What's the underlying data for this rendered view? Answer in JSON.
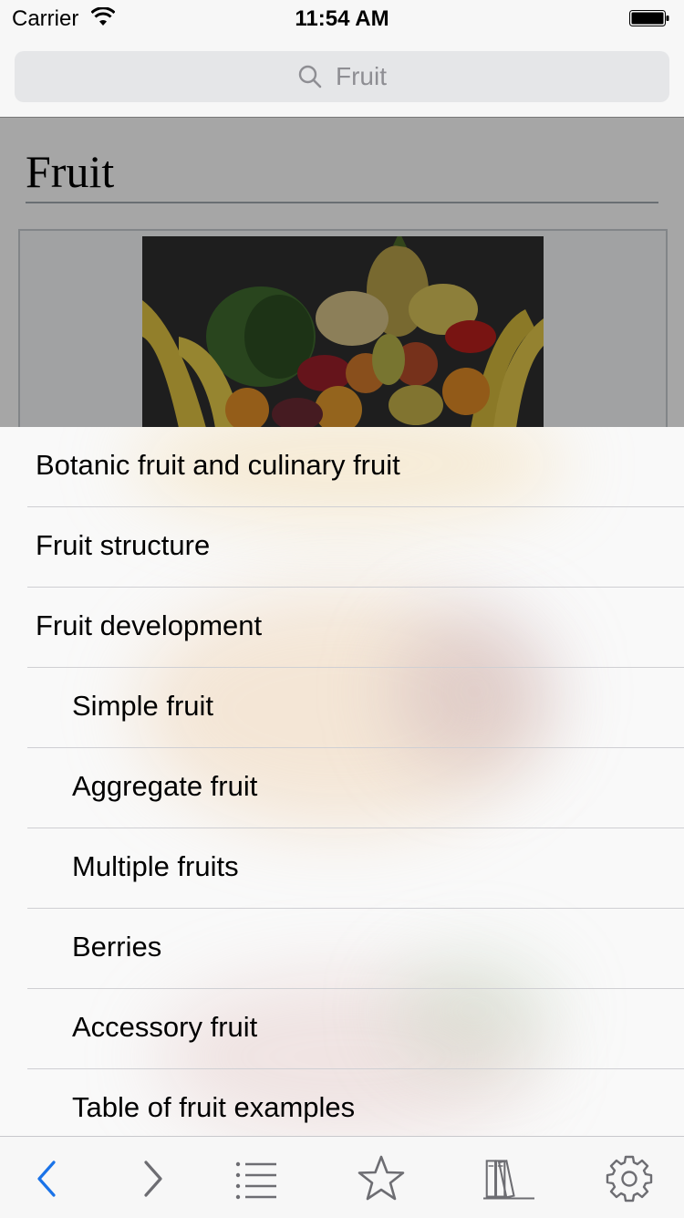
{
  "status_bar": {
    "carrier": "Carrier",
    "time": "11:54 AM"
  },
  "search": {
    "placeholder": "Fruit"
  },
  "article": {
    "title": "Fruit"
  },
  "toc": {
    "items": [
      {
        "label": "Botanic fruit and culinary fruit",
        "level": 1
      },
      {
        "label": "Fruit structure",
        "level": 1
      },
      {
        "label": "Fruit development",
        "level": 1
      },
      {
        "label": "Simple fruit",
        "level": 2
      },
      {
        "label": "Aggregate fruit",
        "level": 2
      },
      {
        "label": "Multiple fruits",
        "level": 2
      },
      {
        "label": "Berries",
        "level": 2
      },
      {
        "label": "Accessory fruit",
        "level": 2
      },
      {
        "label": "Table of fruit examples",
        "level": 2
      }
    ]
  },
  "toolbar": {
    "items": [
      {
        "icon": "back-icon",
        "enabled": true
      },
      {
        "icon": "forward-icon",
        "enabled": true
      },
      {
        "icon": "list-icon",
        "enabled": true
      },
      {
        "icon": "star-icon",
        "enabled": true
      },
      {
        "icon": "library-icon",
        "enabled": true
      },
      {
        "icon": "gear-icon",
        "enabled": true
      }
    ]
  },
  "colors": {
    "accent": "#1a73e8",
    "icon_gray": "#6d6d72"
  }
}
